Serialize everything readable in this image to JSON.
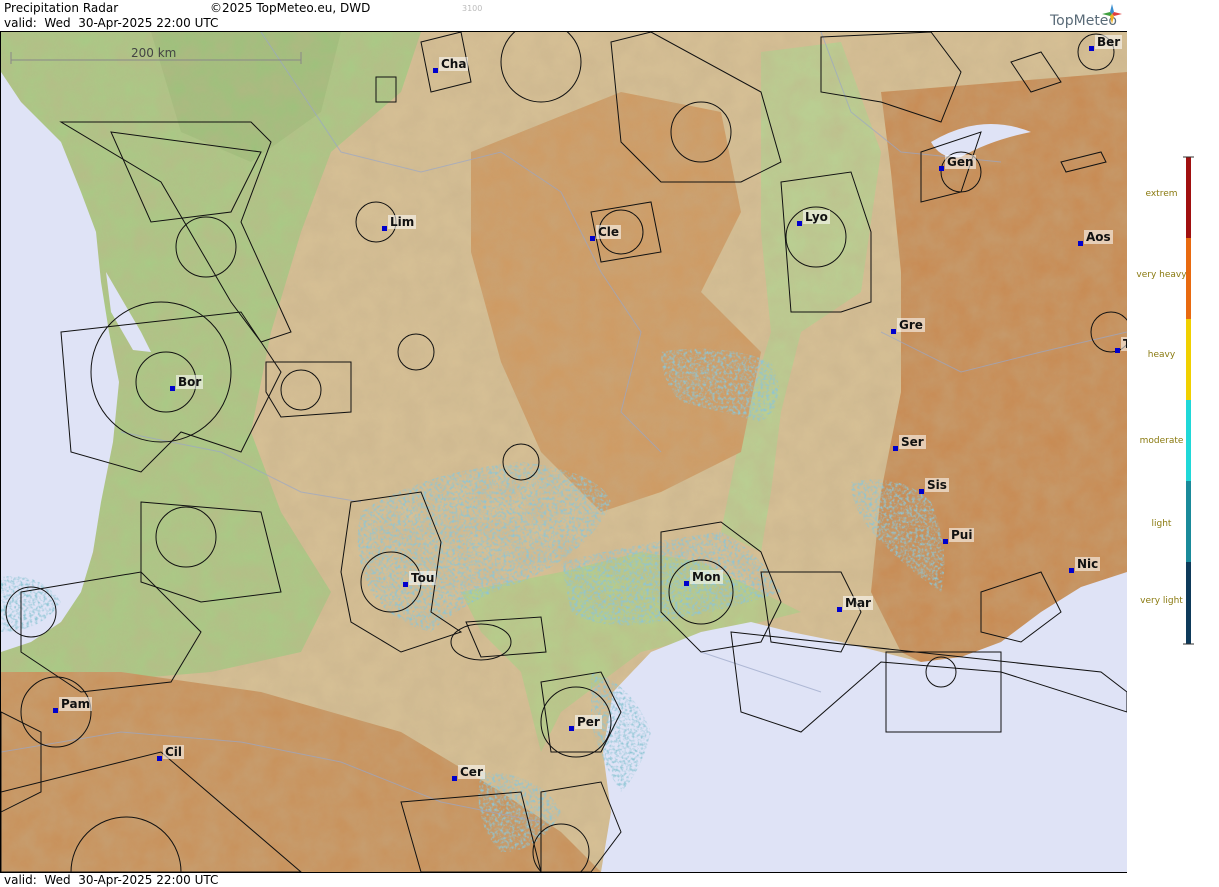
{
  "header": {
    "title": "Precipitation Radar",
    "copyright": "©2025 TopMeteo.eu, DWD",
    "code": "3100",
    "valid": "valid:  Wed  30-Apr-2025 22:00 UTC",
    "brand": "TopMeteo"
  },
  "footer": {
    "valid": "valid:  Wed  30-Apr-2025 22:00 UTC"
  },
  "scale": {
    "label": "200 km"
  },
  "cities": [
    {
      "name": "Cha"
    },
    {
      "name": "Ber"
    },
    {
      "name": "Gen"
    },
    {
      "name": "Lim"
    },
    {
      "name": "Cle"
    },
    {
      "name": "Lyo"
    },
    {
      "name": "Aos"
    },
    {
      "name": "Gre"
    },
    {
      "name": "Bor"
    },
    {
      "name": "Ser"
    },
    {
      "name": "Sis"
    },
    {
      "name": "Pui"
    },
    {
      "name": "Tou"
    },
    {
      "name": "Mon"
    },
    {
      "name": "Nic"
    },
    {
      "name": "Mar"
    },
    {
      "name": "Pam"
    },
    {
      "name": "Per"
    },
    {
      "name": "Cil"
    },
    {
      "name": "Cer"
    },
    {
      "name": "T"
    }
  ],
  "legend": {
    "items": [
      {
        "label": "extrem",
        "color": "#a01010"
      },
      {
        "label": "very heavy",
        "color": "#e86a10"
      },
      {
        "label": "heavy",
        "color": "#f0d000"
      },
      {
        "label": "moderate",
        "color": "#20d8d8"
      },
      {
        "label": "light",
        "color": "#1a8a9a"
      },
      {
        "label": "very light",
        "color": "#0e3a5a"
      }
    ]
  },
  "colors": {
    "sea": "#dfe3f6",
    "land": "#d8c39a",
    "lowland": "#a9cc88",
    "mountain": "#c98a4f",
    "radar": "#4f8ea8",
    "city_marker": "#0000cc"
  }
}
